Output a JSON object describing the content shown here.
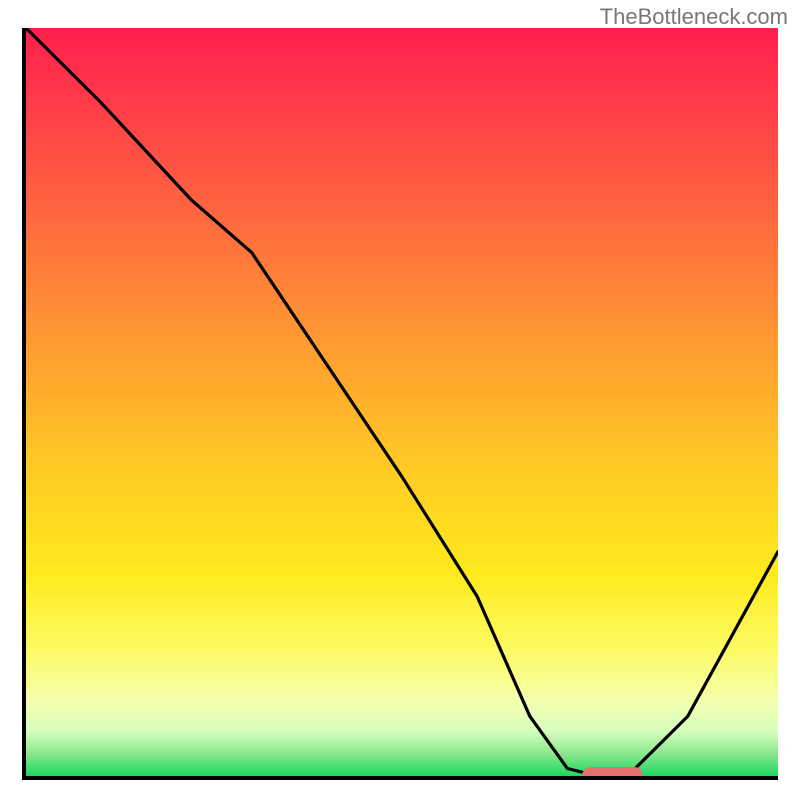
{
  "watermark": "TheBottleneck.com",
  "chart_data": {
    "type": "line",
    "title": "",
    "xlabel": "",
    "ylabel": "",
    "xlim": [
      0,
      100
    ],
    "ylim": [
      0,
      100
    ],
    "grid": false,
    "legend": false,
    "series": [
      {
        "name": "bottleneck-curve",
        "x": [
          0,
          10,
          22,
          30,
          40,
          50,
          60,
          67,
          72,
          76,
          80,
          88,
          100
        ],
        "y": [
          100,
          90,
          77,
          70,
          55,
          40,
          24,
          8,
          1,
          0,
          0,
          8,
          30
        ]
      }
    ],
    "marker": {
      "name": "optimal-range",
      "x_start": 74,
      "x_end": 82,
      "y": 0,
      "color": "#e6706f"
    },
    "gradient_band": {
      "description": "vertical red-to-green gradient fill",
      "stops": [
        {
          "pos": 0.0,
          "color": "#ff1f4d"
        },
        {
          "pos": 0.42,
          "color": "#ff9a32"
        },
        {
          "pos": 0.73,
          "color": "#feea1d"
        },
        {
          "pos": 0.9,
          "color": "#f4ffae"
        },
        {
          "pos": 1.0,
          "color": "#1dd85f"
        }
      ]
    }
  }
}
